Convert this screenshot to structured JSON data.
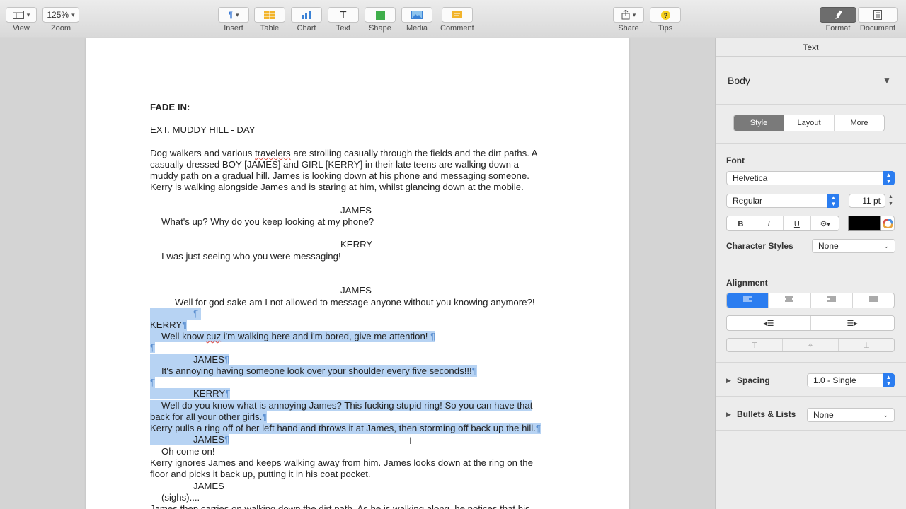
{
  "toolbar": {
    "view": {
      "label": "View"
    },
    "zoom": {
      "value": "125%",
      "label": "Zoom"
    },
    "insert": {
      "label": "Insert"
    },
    "table": {
      "label": "Table"
    },
    "chart": {
      "label": "Chart"
    },
    "text": {
      "label": "Text"
    },
    "shape": {
      "label": "Shape"
    },
    "media": {
      "label": "Media"
    },
    "comment": {
      "label": "Comment"
    },
    "share": {
      "label": "Share"
    },
    "tips": {
      "label": "Tips"
    },
    "format": {
      "label": "Format"
    },
    "document": {
      "label": "Document"
    }
  },
  "document": {
    "lines": [
      {
        "text": "FADE IN:"
      },
      {
        "text": "EXT. MUDDY HILL - DAY"
      },
      {
        "pre": "Dog walkers and various ",
        "spell": "travelers",
        "post": " are strolling casually through the fields and the dirt paths. A"
      },
      {
        "text": "casually dressed BOY [JAMES] and GIRL [KERRY] in their late teens are walking down a"
      },
      {
        "text": "muddy path on a gradual hill. James is looking down at his phone and messaging someone."
      },
      {
        "text": "Kerry is walking alongside James and is staring at him, whilst glancing down at the mobile."
      },
      {
        "text": "JAMES"
      },
      {
        "text": "What's up? Why do you keep looking at my phone?"
      },
      {
        "text": "KERRY"
      },
      {
        "text": "I was just seeing who you were messaging!"
      },
      {
        "text": "JAMES"
      },
      {
        "text": "Well for god sake am I not allowed to message anyone without you knowing anymore?!"
      },
      {
        "text": ""
      },
      {
        "text": "KERRY"
      },
      {
        "pre": "Well know ",
        "spell": "cuz",
        "post": " i'm walking here and i'm bored, give me attention! "
      },
      {
        "text": ""
      },
      {
        "text": "JAMES"
      },
      {
        "text": "It's annoying having someone look over your shoulder every five seconds!!!"
      },
      {
        "text": ""
      },
      {
        "text": "KERRY"
      },
      {
        "text": "Well do you know what is annoying James? This fucking stupid ring! So you can have that"
      },
      {
        "text": "back for all your other girls."
      },
      {
        "text": "Kerry pulls a ring off of her left hand and throws it at James, then storming off back up the hill."
      },
      {
        "text": "JAMES"
      },
      {
        "text": "Oh come on!"
      },
      {
        "text": "Kerry ignores James and keeps walking away from him. James looks down at the ring on the"
      },
      {
        "text": "floor and picks it back up, putting it in his coat pocket."
      },
      {
        "text": "JAMES"
      },
      {
        "text": "(sighs)...."
      },
      {
        "text": "James then carries on walking down the dirt path. As he is walking along, he notices that his"
      }
    ],
    "pilcrow": "¶"
  },
  "sidebar": {
    "title": "Text",
    "paragraph_style": "Body",
    "tabs": [
      "Style",
      "Layout",
      "More"
    ],
    "font_label": "Font",
    "font_family": "Helvetica",
    "font_typeface": "Regular",
    "font_size": "11 pt",
    "bold": "B",
    "italic": "I",
    "underline": "U",
    "text_color": "#000000",
    "character_styles_label": "Character Styles",
    "character_styles_value": "None",
    "alignment_label": "Alignment",
    "spacing_label": "Spacing",
    "spacing_value": "1.0 - Single",
    "bullets_label": "Bullets & Lists",
    "bullets_value": "None"
  },
  "colors": {
    "selection": "#b7d3f3",
    "accent": "#2b7df0"
  }
}
